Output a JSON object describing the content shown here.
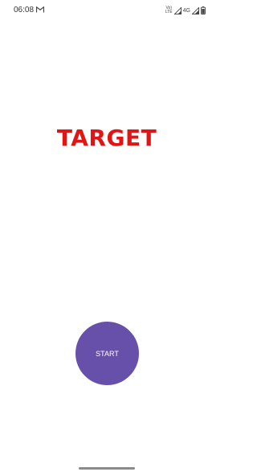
{
  "status_bar": {
    "time": "06:08",
    "volte_top": "Vo)",
    "volte_bottom": "LTE",
    "network": "4G",
    "icons": [
      "gmail-icon",
      "signal-icon",
      "signal-icon",
      "battery-icon"
    ]
  },
  "main": {
    "title": "TARGET",
    "start_label": "START"
  },
  "colors": {
    "title": "#e31414",
    "button": "#6750a9"
  }
}
